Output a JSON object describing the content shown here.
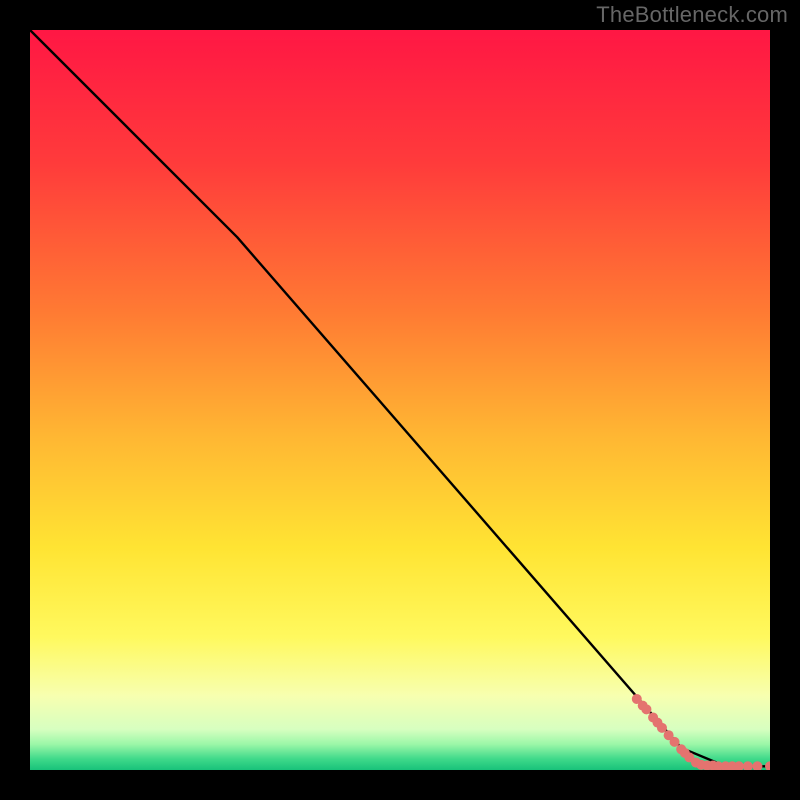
{
  "watermark": "TheBottleneck.com",
  "chart_data": {
    "type": "line",
    "title": "",
    "xlabel": "",
    "ylabel": "",
    "xlim": [
      0,
      100
    ],
    "ylim": [
      0,
      100
    ],
    "gradient_stops": [
      {
        "offset": 0.0,
        "color": "#ff1744"
      },
      {
        "offset": 0.18,
        "color": "#ff3b3b"
      },
      {
        "offset": 0.38,
        "color": "#ff7a33"
      },
      {
        "offset": 0.55,
        "color": "#ffb733"
      },
      {
        "offset": 0.7,
        "color": "#ffe433"
      },
      {
        "offset": 0.82,
        "color": "#fff95e"
      },
      {
        "offset": 0.9,
        "color": "#f7ffb0"
      },
      {
        "offset": 0.945,
        "color": "#d7ffc0"
      },
      {
        "offset": 0.965,
        "color": "#9cf7a8"
      },
      {
        "offset": 0.985,
        "color": "#3fd98a"
      },
      {
        "offset": 1.0,
        "color": "#18c27a"
      }
    ],
    "series": [
      {
        "name": "bottleneck-curve",
        "color": "#000000",
        "x": [
          0,
          28,
          88,
          94,
          100
        ],
        "y": [
          100,
          72,
          3,
          0.5,
          0.5
        ]
      }
    ],
    "scatter": {
      "name": "data-points",
      "color": "#e4736f",
      "radius": 5,
      "points": [
        {
          "x": 82.0,
          "y": 9.6
        },
        {
          "x": 82.8,
          "y": 8.7
        },
        {
          "x": 83.3,
          "y": 8.2
        },
        {
          "x": 84.2,
          "y": 7.1
        },
        {
          "x": 84.8,
          "y": 6.4
        },
        {
          "x": 85.4,
          "y": 5.7
        },
        {
          "x": 86.3,
          "y": 4.7
        },
        {
          "x": 87.1,
          "y": 3.8
        },
        {
          "x": 88.0,
          "y": 2.8
        },
        {
          "x": 88.5,
          "y": 2.3
        },
        {
          "x": 89.1,
          "y": 1.7
        },
        {
          "x": 90.0,
          "y": 1.0
        },
        {
          "x": 90.7,
          "y": 0.7
        },
        {
          "x": 91.5,
          "y": 0.6
        },
        {
          "x": 92.3,
          "y": 0.6
        },
        {
          "x": 93.0,
          "y": 0.5
        },
        {
          "x": 94.0,
          "y": 0.5
        },
        {
          "x": 94.9,
          "y": 0.5
        },
        {
          "x": 95.8,
          "y": 0.5
        },
        {
          "x": 97.0,
          "y": 0.5
        },
        {
          "x": 98.3,
          "y": 0.5
        },
        {
          "x": 100.0,
          "y": 0.5
        }
      ]
    }
  }
}
